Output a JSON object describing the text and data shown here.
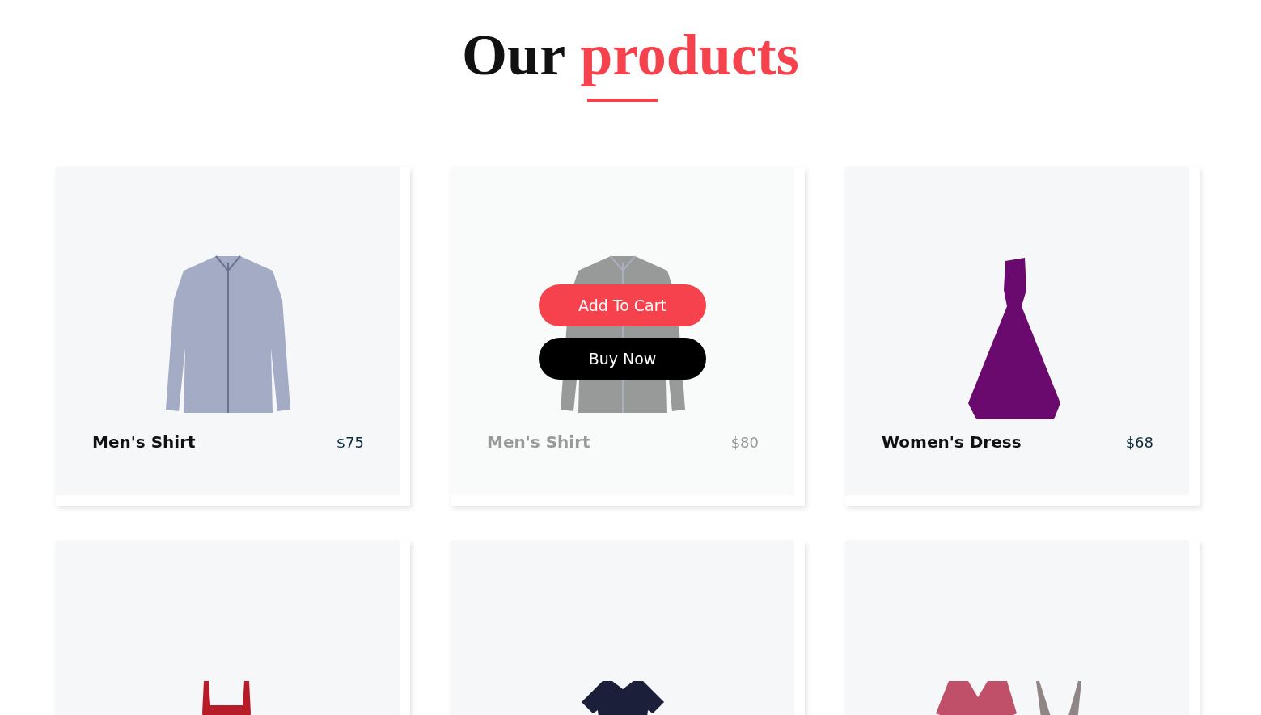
{
  "heading": {
    "text": "Our",
    "highlight": "products"
  },
  "products": [
    {
      "kind": "shirt",
      "name": "Men's Shirt",
      "price": "$75",
      "hovered": false
    },
    {
      "kind": "dark-shirt",
      "name": "Men's Shirt",
      "price": "$80",
      "hovered": true,
      "buttons": [
        {
          "label": "Add To Cart",
          "kind": "primary"
        },
        {
          "label": "Buy Now",
          "kind": "dark"
        }
      ]
    },
    {
      "kind": "gown",
      "name": "Women's Dress",
      "price": "$68",
      "hovered": false
    },
    {
      "kind": "red-dress",
      "hovered": false
    },
    {
      "kind": "navy-dress",
      "hovered": false
    },
    {
      "kind": "two-dresses",
      "hovered": false
    }
  ]
}
